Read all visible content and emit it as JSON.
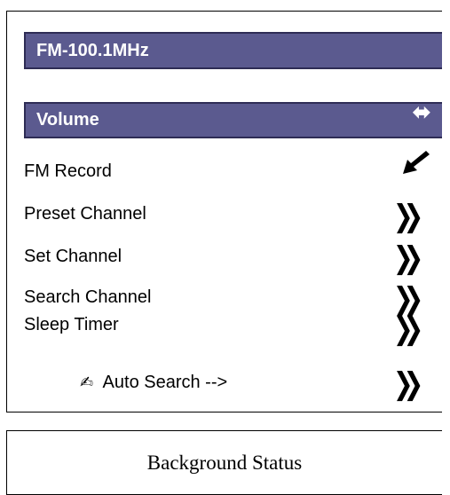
{
  "frequency_bar": {
    "label": "FM-100.1MHz"
  },
  "volume_bar": {
    "label": "Volume",
    "icon": "left-right-arrows-icon"
  },
  "menu": {
    "items": [
      {
        "label": "FM Record",
        "icon": "arrow-down-left-icon",
        "icon_glyph": "➘"
      },
      {
        "label": "Preset Channel",
        "icon": "double-chevron-right-icon",
        "icon_glyph": "❯❯"
      },
      {
        "label": "Set Channel",
        "icon": "double-chevron-right-icon",
        "icon_glyph": "❯❯"
      },
      {
        "label": "Search Channel",
        "icon": "double-chevron-right-icon",
        "icon_glyph": "❯❯"
      },
      {
        "label": "Sleep Timer",
        "icon": "double-chevron-right-icon",
        "icon_glyph": "❯❯"
      }
    ],
    "auto_search": {
      "prefix_icon": "pen-icon",
      "prefix_glyph": "✍",
      "label": "Auto Search -->",
      "icon_glyph": "❯❯"
    }
  },
  "status": {
    "label": "Background Status"
  }
}
